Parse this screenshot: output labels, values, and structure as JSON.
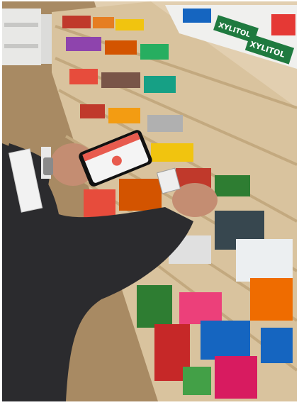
{
  "scene": {
    "shelf_signs": [
      {
        "text": "XYLITOL"
      },
      {
        "text": "XYLITOL"
      }
    ],
    "colors": {
      "floor": "#a88a63",
      "wall": "#e2cfb0",
      "shelf": "#d9c39e",
      "jacket": "#2b2b2e",
      "skin": "#c48d72",
      "phone_screen": "#e85b4e",
      "xylitol_green": "#1f7a3f"
    }
  }
}
